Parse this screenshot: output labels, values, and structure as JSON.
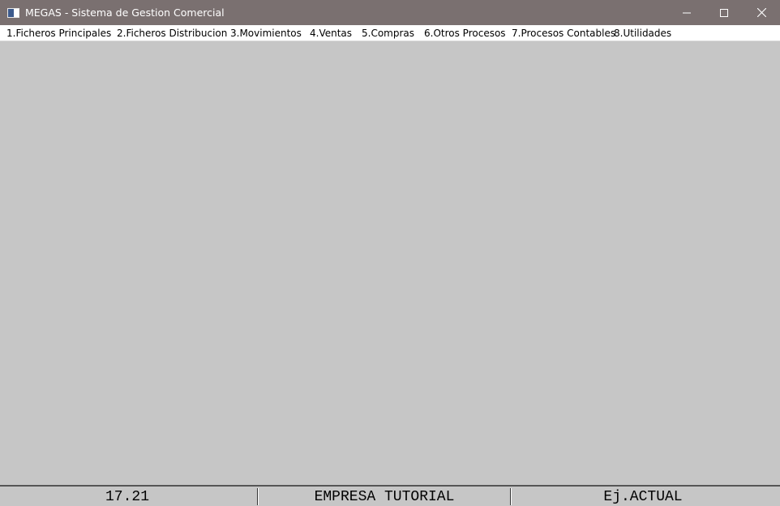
{
  "window": {
    "title": "MEGAS - Sistema de Gestion Comercial",
    "icon": "app-window-icon",
    "controls": [
      "minimize-icon",
      "maximize-icon",
      "close-icon"
    ]
  },
  "menu": {
    "items": [
      {
        "label": "1.Ficheros Principales"
      },
      {
        "label": "2.Ficheros Distribucion"
      },
      {
        "label": "3.Movimientos"
      },
      {
        "label": "4.Ventas"
      },
      {
        "label": "5.Compras"
      },
      {
        "label": "6.Otros Procesos"
      },
      {
        "label": "7.Procesos Contables"
      },
      {
        "label": "8.Utilidades"
      }
    ]
  },
  "status": {
    "version": "17.21",
    "company": "EMPRESA TUTORIAL",
    "exercise": "Ej.ACTUAL"
  },
  "colors": {
    "titlebar": "#7a7070",
    "workspace": "#c6c6c6",
    "menubar": "#ffffff"
  }
}
